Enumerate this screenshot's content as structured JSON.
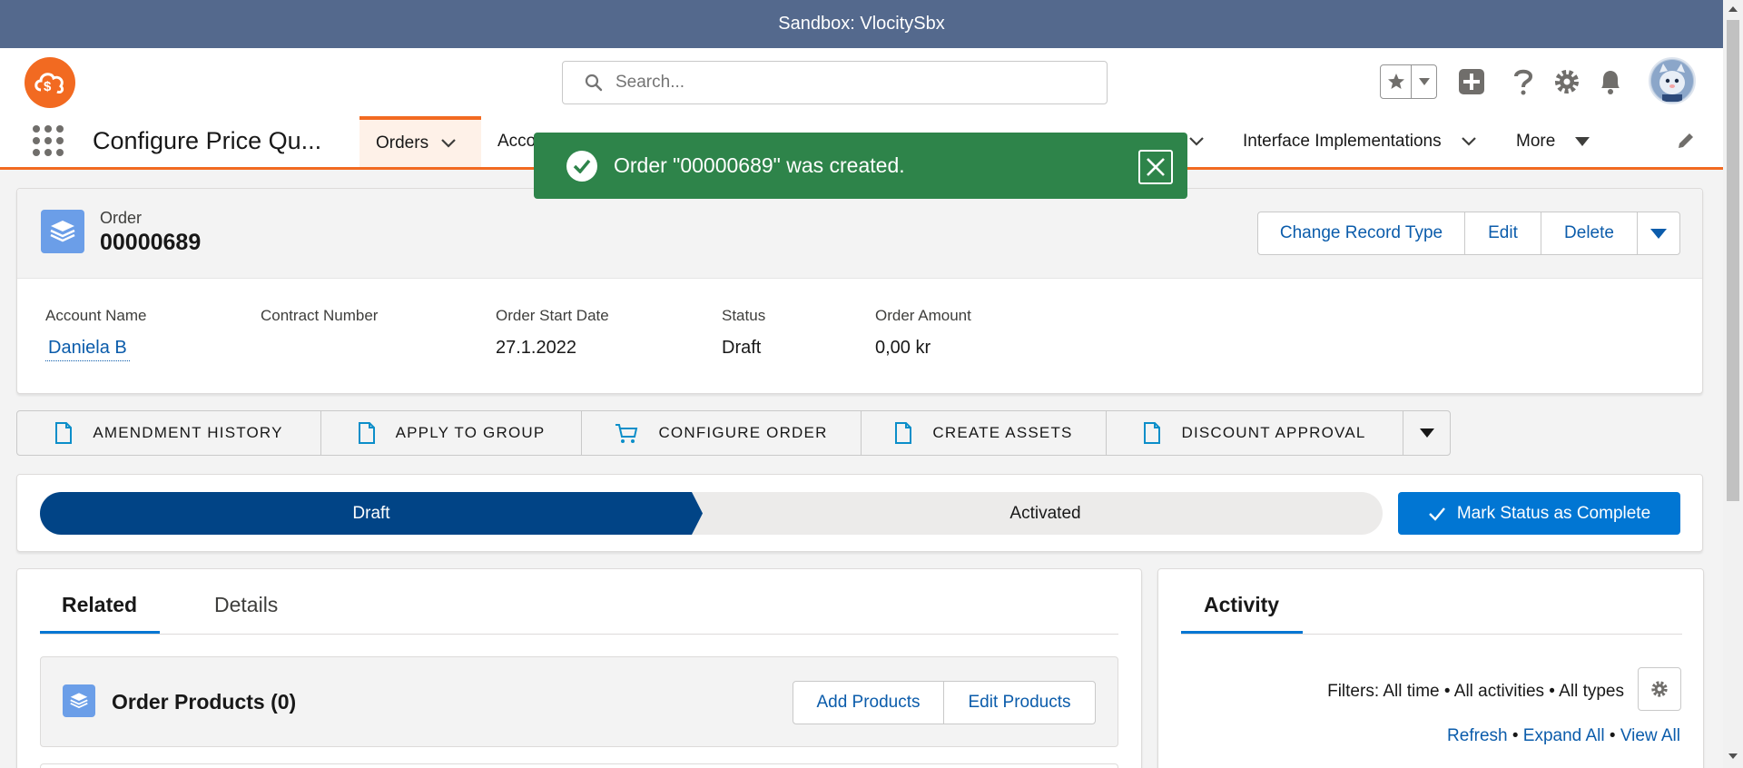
{
  "sandbox": {
    "label": "Sandbox: VlocitySbx"
  },
  "header": {
    "search_placeholder": "Search..."
  },
  "nav": {
    "app_name": "Configure Price Qu...",
    "items": [
      {
        "label": "Orders",
        "active": true
      },
      {
        "label": "Acco"
      },
      {
        "label": "Interface Implementations"
      },
      {
        "label": "More"
      }
    ]
  },
  "toast": {
    "message": "Order \"00000689\" was created."
  },
  "record": {
    "object_label": "Order",
    "title": "00000689",
    "buttons": [
      "Change Record Type",
      "Edit",
      "Delete"
    ],
    "fields": [
      {
        "label": "Account Name",
        "value": "Daniela B"
      },
      {
        "label": "Contract Number",
        "value": ""
      },
      {
        "label": "Order Start Date",
        "value": "27.1.2022"
      },
      {
        "label": "Status",
        "value": "Draft"
      },
      {
        "label": "Order Amount",
        "value": "0,00 kr"
      }
    ]
  },
  "actions": [
    "AMENDMENT HISTORY",
    "APPLY TO GROUP",
    "CONFIGURE ORDER",
    "CREATE ASSETS",
    "DISCOUNT APPROVAL"
  ],
  "path": {
    "steps": [
      "Draft",
      "Activated"
    ],
    "current": "Draft",
    "mark_button": "Mark Status as Complete"
  },
  "tabs": {
    "related": "Related",
    "details": "Details"
  },
  "related_list": {
    "title": "Order Products (0)",
    "add_button": "Add Products",
    "edit_button": "Edit Products"
  },
  "activity": {
    "tab": "Activity",
    "filters": "Filters: All time • All activities • All types",
    "refresh": "Refresh",
    "expand_all": "Expand All",
    "view_all": "View All",
    "sep": "•"
  },
  "colors": {
    "brand_orange": "#f26a21",
    "sandbox_bar": "#54698d",
    "toast_success": "#2e844a",
    "path_active": "#014486",
    "primary_button": "#0176d3",
    "link": "#0b5cab"
  }
}
